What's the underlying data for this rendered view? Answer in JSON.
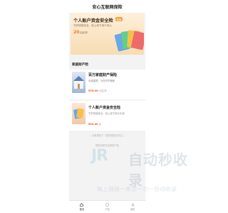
{
  "header": {
    "title": "安心互联网保险"
  },
  "banner": {
    "title": "个人账户资金安全险",
    "badge": "热卖",
    "subtitle": "守护钱袋安全，线上线下用卡安心",
    "price_value": "20",
    "price_unit": "元起/年"
  },
  "section": {
    "title": "家庭财产险"
  },
  "products": [
    {
      "title": "百万家庭财产保险",
      "subtitle": "多重保障，为您守护随家",
      "price": "¥78.00",
      "price_note": "元起/年"
    },
    {
      "title": "个人账户资金安全险",
      "subtitle": "守护钱袋安全，线上线下用卡无忧",
      "price": "¥20.00",
      "price_note": "起"
    }
  ],
  "footer": {
    "line1": "— 没有更多了 / 更多保险请关注 —",
    "line2": "提供优质安全保险产品"
  },
  "tabbar": {
    "items": [
      {
        "label": "首页",
        "icon": "home-icon",
        "active": true
      },
      {
        "label": "产品",
        "icon": "product-icon",
        "active": false
      },
      {
        "label": "我的",
        "icon": "user-icon",
        "active": false
      }
    ]
  },
  "watermark": {
    "logo": "JR",
    "title": "自动秒收录",
    "subtitle": "做上链接一来访一次一自动收录"
  },
  "colors": {
    "accent": "#f07a1e",
    "price_red": "#f0502a",
    "banner_bg": "#f8dcb3"
  }
}
